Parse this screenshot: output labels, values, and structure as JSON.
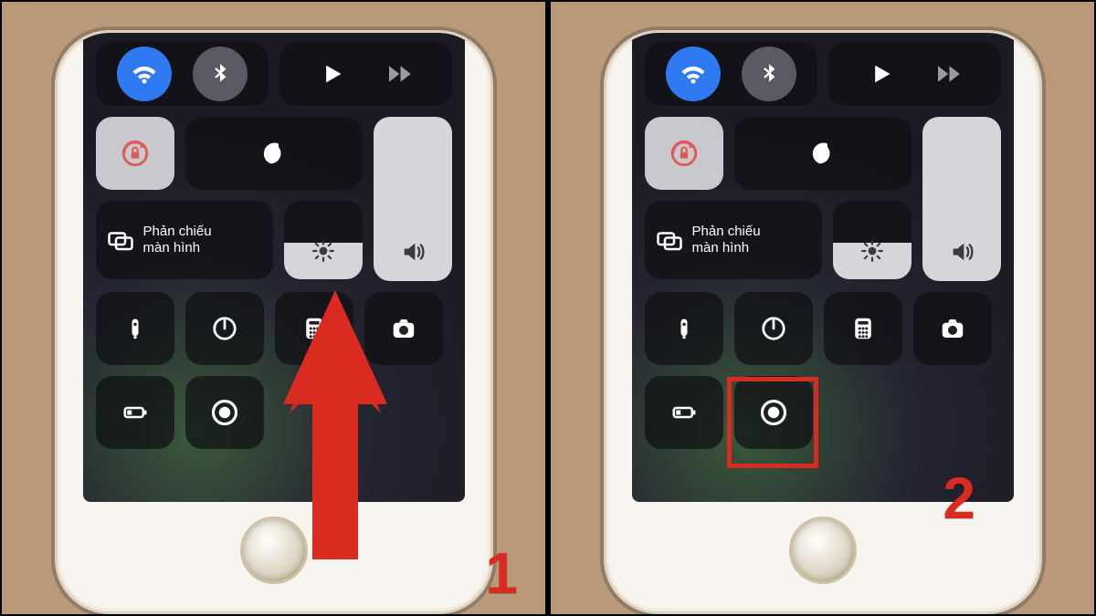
{
  "steps": {
    "one": "1",
    "two": "2"
  },
  "mirror": {
    "line1": "Phản chiếu",
    "line2": "màn hình"
  },
  "sliders": {
    "brightness_fill_pct": 46,
    "volume_fill_pct": 100
  },
  "colors": {
    "accent_red": "#d92b1f",
    "wifi_blue": "#2f7af3"
  },
  "icons": {
    "wifi": "wifi-icon",
    "bluetooth": "bluetooth-icon",
    "play": "play-icon",
    "forward": "forward-icon",
    "rotation_lock": "rotation-lock-icon",
    "dnd": "moon-icon",
    "mirror": "screen-mirroring-icon",
    "brightness": "brightness-icon",
    "volume": "volume-icon",
    "flashlight": "flashlight-icon",
    "timer": "timer-icon",
    "calculator": "calculator-icon",
    "camera": "camera-icon",
    "low_power": "low-power-icon",
    "record": "screen-record-icon"
  }
}
